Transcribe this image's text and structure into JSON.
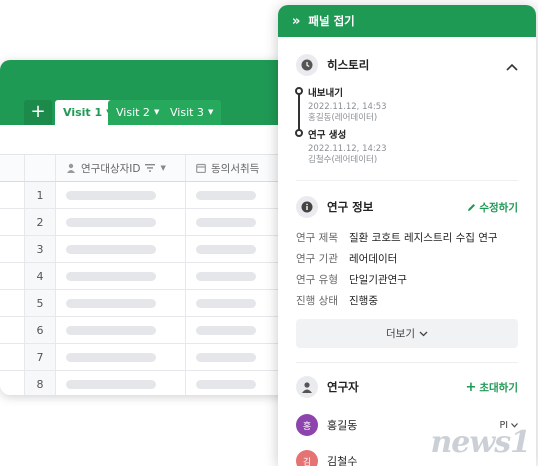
{
  "sheet": {
    "add_label": "+",
    "tabs": [
      {
        "label": "Visit 1",
        "active": true
      },
      {
        "label": "Visit 2",
        "active": false
      },
      {
        "label": "Visit 3",
        "active": false
      }
    ],
    "columns": [
      "연구대상자ID",
      "동의서취득"
    ],
    "row_numbers": [
      "1",
      "2",
      "3",
      "4",
      "5",
      "6",
      "7",
      "8"
    ]
  },
  "panel": {
    "header_label": "패널 접기",
    "history": {
      "title": "히스토리",
      "items": [
        {
          "title": "내보내기",
          "date": "2022.11.12, 14:53",
          "user": "홍길동(레어데이터)"
        },
        {
          "title": "연구 생성",
          "date": "2022.11.12, 14:23",
          "user": "김철수(레어데이터)"
        }
      ]
    },
    "study_info": {
      "title": "연구 정보",
      "edit_label": "수정하기",
      "rows": [
        {
          "label": "연구 제목",
          "value": "질환 코호트 레지스트리 수집 연구"
        },
        {
          "label": "연구 기관",
          "value": "레어데이터"
        },
        {
          "label": "연구 유형",
          "value": "단일기관연구"
        },
        {
          "label": "진행 상태",
          "value": "진행중"
        }
      ],
      "more_label": "더보기"
    },
    "researchers": {
      "title": "연구자",
      "invite_label": "초대하기",
      "members": [
        {
          "initial": "홍",
          "name": "홍길동",
          "role": "PI",
          "color": "#8e44ad"
        },
        {
          "initial": "김",
          "name": "김철수",
          "role": "",
          "color": "#e57373"
        }
      ]
    }
  },
  "watermark": "news1",
  "colors": {
    "brand_green": "#1f9a55"
  }
}
